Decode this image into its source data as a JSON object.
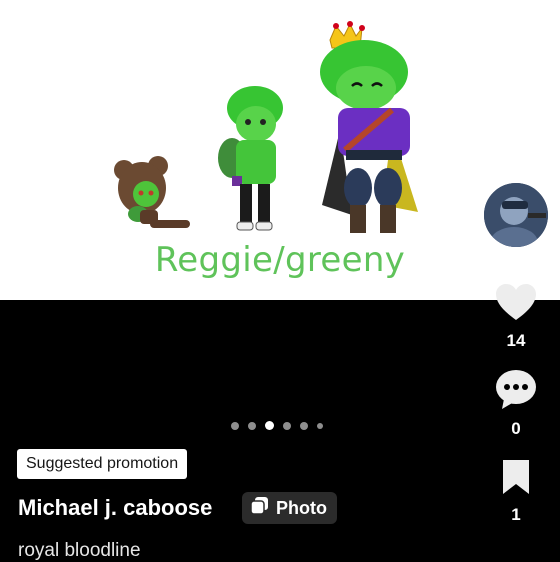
{
  "post": {
    "image_caption": "Reggie/greeny",
    "carousel": {
      "total": 6,
      "active_index": 2
    },
    "badge": "Suggested promotion",
    "author": "Michael j. caboose",
    "type_chip": "Photo",
    "description": "royal bloodline"
  },
  "actions": {
    "likes": "14",
    "comments": "0",
    "saves": "1"
  },
  "icons": [
    "heart-icon",
    "comment-icon",
    "bookmark-icon",
    "photo-icon",
    "avatar"
  ],
  "colors": {
    "caption_green": "#5fc35a",
    "background": "#000000"
  }
}
